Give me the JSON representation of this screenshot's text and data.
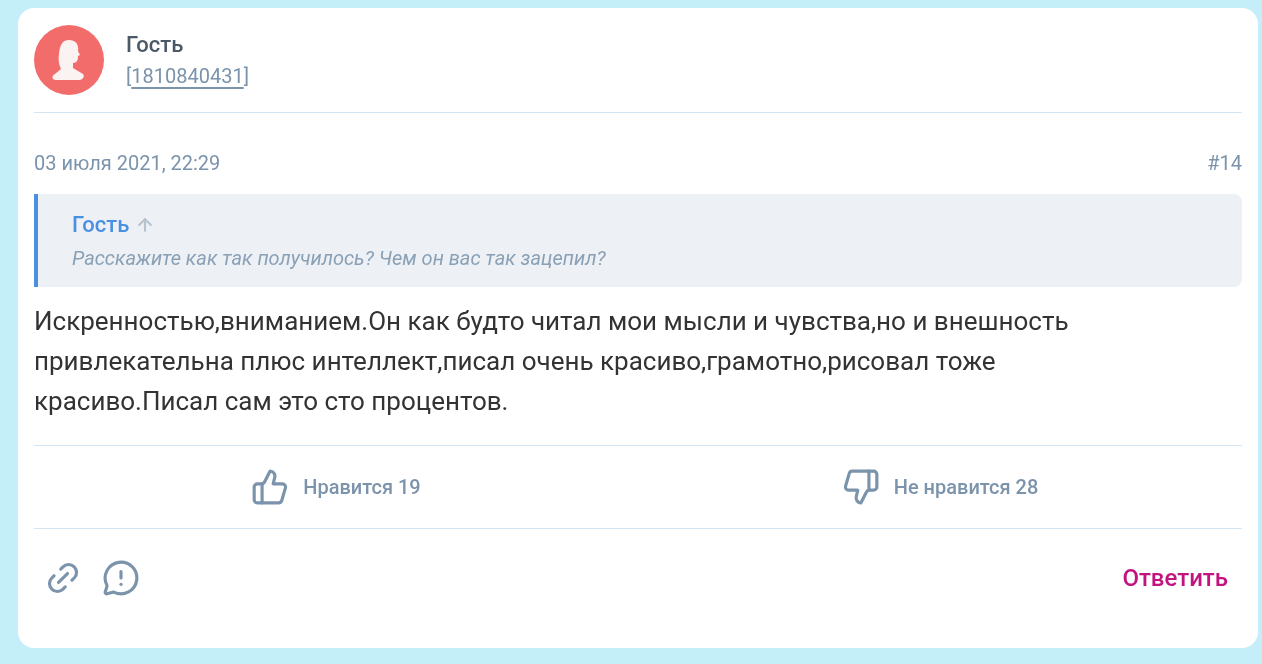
{
  "author": {
    "name": "Гость",
    "id_open": "[",
    "id": "1810840431",
    "id_close": "]"
  },
  "post": {
    "date": "03 июля 2021, 22:29",
    "number": "#14"
  },
  "quote": {
    "author": "Гость",
    "text": "Расскажите как так получилось? Чем он вас так зацепил?"
  },
  "body": "Искренностью,вниманием.Он как будто читал мои мысли и чувства,но и внешность привлекательна плюс интеллект,писал очень красиво,грамотно,рисовал тоже красиво.Писал сам это сто процентов.",
  "votes": [
    {
      "kind": "like",
      "label": "Нравится 19"
    },
    {
      "kind": "dislike",
      "label": "Не нравится 28"
    }
  ],
  "reply": "Ответить"
}
